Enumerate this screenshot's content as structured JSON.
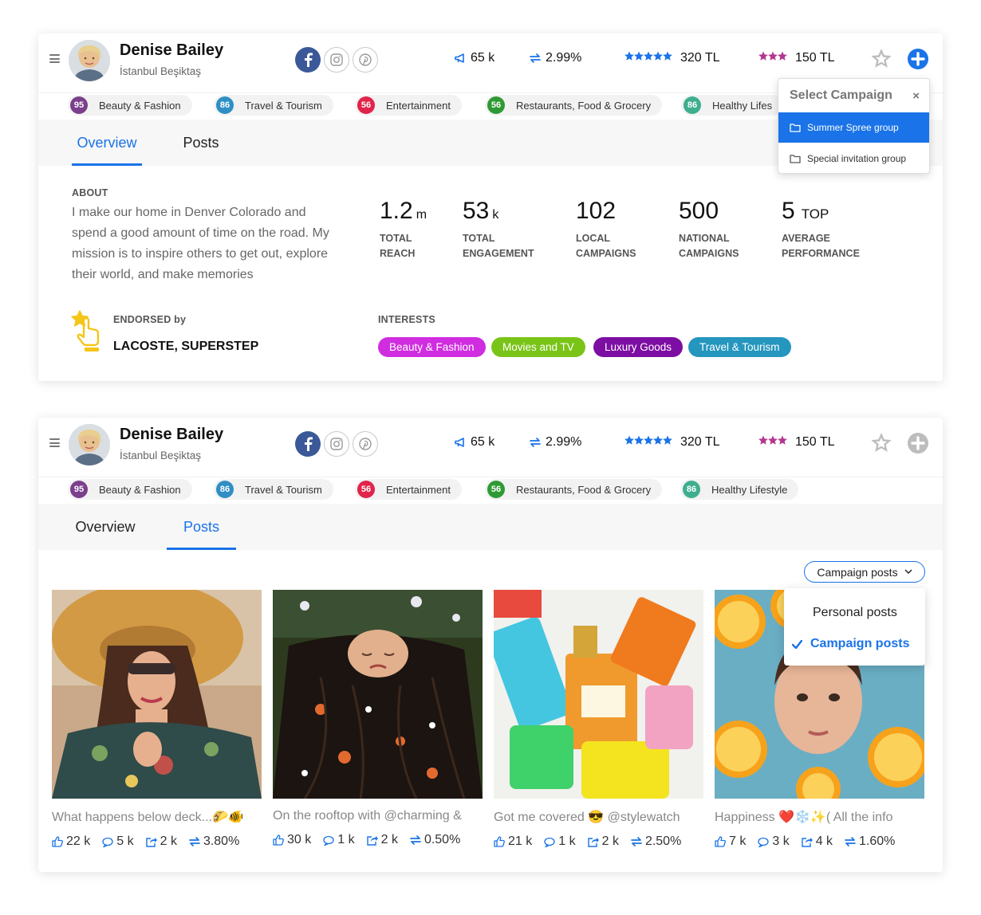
{
  "profile": {
    "name": "Denise Bailey",
    "location": "İstanbul Beşiktaş"
  },
  "header_stats": {
    "followers": "65 k",
    "engagement_rate": "2.99%",
    "rating_a": "320 TL",
    "rating_b": "150 TL",
    "rating_a_stars": 5,
    "rating_b_stars": 3
  },
  "categories": [
    {
      "score": "95",
      "label": "Beauty & Fashion",
      "color": "#7b3f8c"
    },
    {
      "score": "86",
      "label": "Travel & Tourism",
      "color": "#2f8fc4"
    },
    {
      "score": "56",
      "label": "Entertainment",
      "color": "#e0244a"
    },
    {
      "score": "56",
      "label": "Restaurants, Food & Grocery",
      "color": "#2e9a33"
    },
    {
      "score": "86",
      "label": "Healthy Lifestyle",
      "color": "#3fae8e"
    }
  ],
  "card1_categories_visible_last": "Healthy Lifes",
  "tabs": [
    "Overview",
    "Posts"
  ],
  "about": {
    "label": "ABOUT",
    "text": "I make our home in Denver Colorado and spend a good amount of time on the road. My mission is to inspire others to get out, explore their world, and make memories"
  },
  "metrics": [
    {
      "value": "1.2",
      "unit": "m",
      "label1": "TOTAL",
      "label2": "REACH"
    },
    {
      "value": "53",
      "unit": "k",
      "label1": "TOTAL",
      "label2": "ENGAGEMENT"
    },
    {
      "value": "102",
      "unit": "",
      "label1": "LOCAL",
      "label2": "CAMPAIGNS"
    },
    {
      "value": "500",
      "unit": "",
      "label1": "NATIONAL",
      "label2": "CAMPAIGNS"
    },
    {
      "value": "5",
      "unit": "TOP",
      "label1": "AVERAGE",
      "label2": "PERFORMANCE"
    }
  ],
  "endorsed": {
    "label": "ENDORSED by",
    "names": "LACOSTE, SUPERSTEP"
  },
  "interests": {
    "label": "INTERESTS",
    "items": [
      {
        "label": "Beauty & Fashion",
        "color": "#d02ce0"
      },
      {
        "label": "Movies and TV",
        "color": "#7ac418"
      },
      {
        "label": "Luxury Goods",
        "color": "#7d0ea3"
      },
      {
        "label": "Travel & Tourism",
        "color": "#2596be"
      }
    ]
  },
  "select_campaign": {
    "title": "Select Campaign",
    "close": "×",
    "items": [
      "Summer Spree group",
      "Special invitation group"
    ],
    "selected_index": 0
  },
  "posts_filter": {
    "button_label": "Campaign posts",
    "options": [
      "Personal posts",
      "Campaign posts"
    ],
    "selected": "Campaign posts"
  },
  "posts": [
    {
      "caption": "What happens below deck...🌮🐠",
      "likes": "22 k",
      "comments": "5 k",
      "shares": "2 k",
      "rate": "3.80%"
    },
    {
      "caption": "On the rooftop with @charming &",
      "likes": "30 k",
      "comments": "1 k",
      "shares": "2 k",
      "rate": "0.50%"
    },
    {
      "caption": "Got me covered 😎 @stylewatch",
      "likes": "21 k",
      "comments": "1 k",
      "shares": "2 k",
      "rate": "2.50%"
    },
    {
      "caption": "Happiness ❤️❄️✨( All the info",
      "likes": "7 k",
      "comments": "3 k",
      "shares": "4 k",
      "rate": "1.60%"
    }
  ],
  "colors": {
    "accent": "#1a73e8",
    "facebook": "#3b5998",
    "star_blue": "#1a73e8",
    "star_purple": "#b2378f",
    "trophy_yellow": "#f5c518"
  }
}
